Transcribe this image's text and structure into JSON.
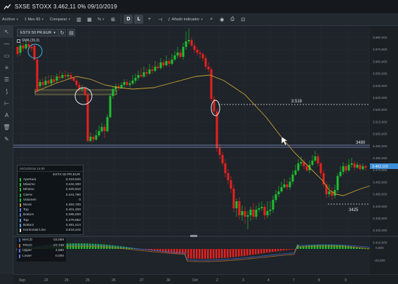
{
  "window": {
    "title": "SXSE STOXX 3.462,11 0% 09/10/2019"
  },
  "toolbar": {
    "archivo_label": "Archivo",
    "period_label": "1 Mes 60",
    "compare_label": "Comparar",
    "percent_label": "%",
    "mode_d": "D",
    "mode_l": "L",
    "add_indicator_label": "Añadir indicador"
  },
  "chart_header": {
    "symbol_label": "ESTX 50 PR.EUR",
    "indicator_label": "SMA (35,0)"
  },
  "price_axis": [
    "3.880,000",
    "3.870,000",
    "3.860,000",
    "3.550,000",
    "3.540,000",
    "3.530,000",
    "3.520,000",
    "3.510,000",
    "3.500,000",
    "3.490,000",
    "3.480,000",
    "3.470,000",
    "3.460,000",
    "3.450,000",
    "3.440,000",
    "3.430,000",
    "3.420,000",
    "3.410,000"
  ],
  "current_price_tag": "3.462,110",
  "horizontal_labels": {
    "h1": "3.518",
    "h2": "3480",
    "h3": "3425"
  },
  "date_axis": [
    "Sep",
    "23",
    "24",
    "25",
    "26",
    "27",
    "30",
    "Oct",
    "2",
    "3",
    "4",
    "7",
    "8",
    "9"
  ],
  "info_panel": {
    "header": "04/10/2019 14:00",
    "title": "ESTX 50 PR.EUR",
    "rows": [
      {
        "key": "Apertura",
        "value": "3.423,940"
      },
      {
        "key": "Máximo",
        "value": "3.442,300"
      },
      {
        "key": "Mínimo",
        "value": "3.420,910"
      },
      {
        "key": "Cierre",
        "value": "3.441,790"
      },
      {
        "key": "Volumen",
        "value": "0"
      },
      {
        "key": "MovS",
        "value": "3.462,700"
      },
      {
        "key": "Top",
        "value": "3.401,200"
      },
      {
        "key": "Bottom",
        "value": "3.395,000"
      },
      {
        "key": "Top",
        "value": "3.479,852"
      },
      {
        "key": "Bottom",
        "value": "3.481,414"
      },
      {
        "key": "Horizontal Line",
        "value": "3.518,242"
      }
    ]
  },
  "macd_panel": {
    "rows": [
      {
        "key": "MACD",
        "value": "-23,069"
      },
      {
        "key": "TRGG",
        "value": "-27,749"
      },
      {
        "key": "Upper",
        "value": "4,680"
      },
      {
        "key": "Lower",
        "value": "0,000"
      }
    ],
    "axis": [
      "0,000",
      "-20,000"
    ]
  },
  "colors": {
    "up": "#1fbf2f",
    "down": "#e8211e",
    "sma": "#c9a232",
    "accent": "#3b8fd8",
    "hline": "#b9bec3"
  }
}
